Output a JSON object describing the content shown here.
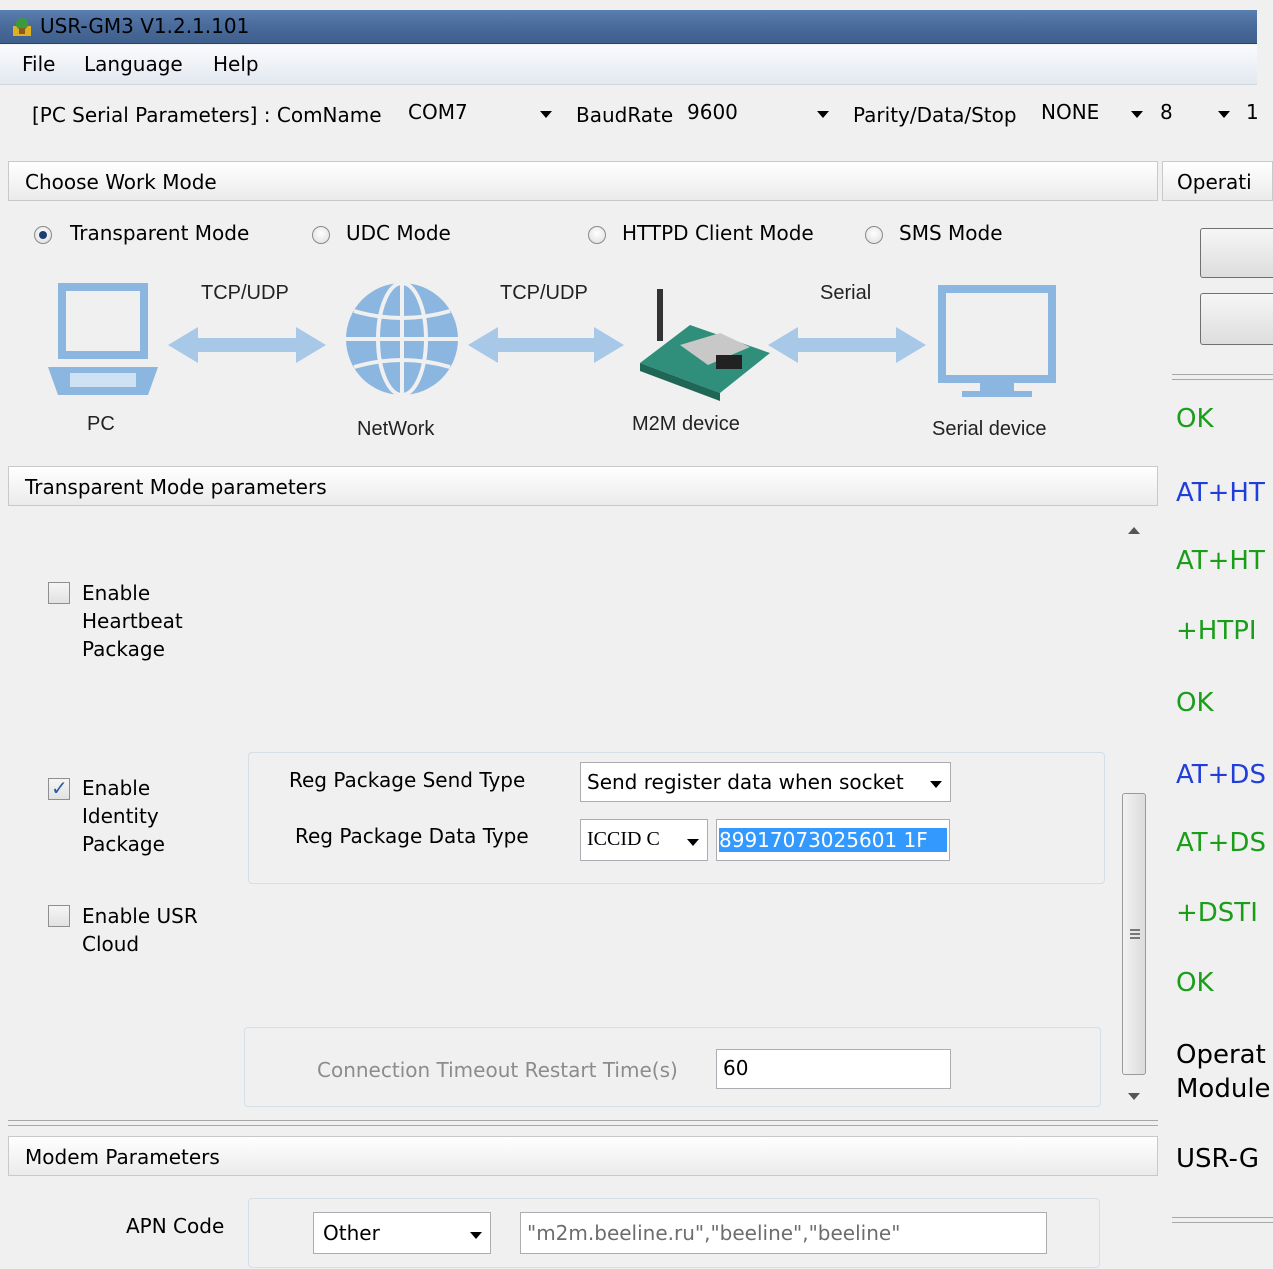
{
  "window": {
    "title": "USR-GM3 V1.2.1.101"
  },
  "menu": [
    "File",
    "Language",
    "Help"
  ],
  "serial": {
    "label_prefix": "[PC Serial Parameters] : ComName",
    "comname": "COM7",
    "baudrate_label": "BaudRate",
    "baudrate": "9600",
    "parity_label": "Parity/Data/Stop",
    "parity": "NONE",
    "data_bits": "8",
    "stop_bits": "1"
  },
  "work_mode": {
    "header": "Choose Work Mode",
    "options": [
      "Transparent Mode",
      "UDC Mode",
      "HTTPD Client Mode",
      "SMS Mode"
    ],
    "selected": "Transparent Mode"
  },
  "diagram": {
    "arrow_labels": [
      "TCP/UDP",
      "TCP/UDP",
      "Serial"
    ],
    "nodes": [
      "PC",
      "NetWork",
      "M2M device",
      "Serial device"
    ]
  },
  "transparent": {
    "header": "Transparent Mode parameters",
    "heartbeat_label": "Enable Heartbeat Package",
    "heartbeat_checked": false,
    "identity_label": "Enable Identity Package",
    "identity_checked": true,
    "reg_send_type_label": "Reg Package Send Type",
    "reg_send_type_value": "Send register data when socket",
    "reg_data_type_label": "Reg Package Data Type",
    "reg_data_type_value": "ICCID C",
    "reg_data_value": "89917073025601 1F",
    "usr_cloud_label": "Enable USR Cloud",
    "usr_cloud_checked": false,
    "timeout_label": "Connection Timeout Restart Time(s)",
    "timeout_value": "60"
  },
  "modem": {
    "header": "Modem Parameters",
    "apn_label": "APN Code",
    "apn_select": "Other",
    "apn_value": "\"m2m.beeline.ru\",\"beeline\",\"beeline\""
  },
  "right_pane": {
    "header": "Operati",
    "log": [
      {
        "text": "OK",
        "color": "#1a9e1a"
      },
      {
        "text": "AT+HT",
        "color": "#1f3fd8"
      },
      {
        "text": "AT+HT",
        "color": "#1a9e1a"
      },
      {
        "text": "+HTPI",
        "color": "#1a9e1a"
      },
      {
        "text": "OK",
        "color": "#1a9e1a"
      },
      {
        "text": "AT+DS",
        "color": "#1f3fd8"
      },
      {
        "text": "AT+DS",
        "color": "#1a9e1a"
      },
      {
        "text": "+DSTI",
        "color": "#1a9e1a"
      },
      {
        "text": "OK",
        "color": "#1a9e1a"
      },
      {
        "text": "Operat",
        "color": "#000000"
      },
      {
        "text": "Module",
        "color": "#000000"
      },
      {
        "text": "USR-G",
        "color": "#000000"
      }
    ]
  }
}
